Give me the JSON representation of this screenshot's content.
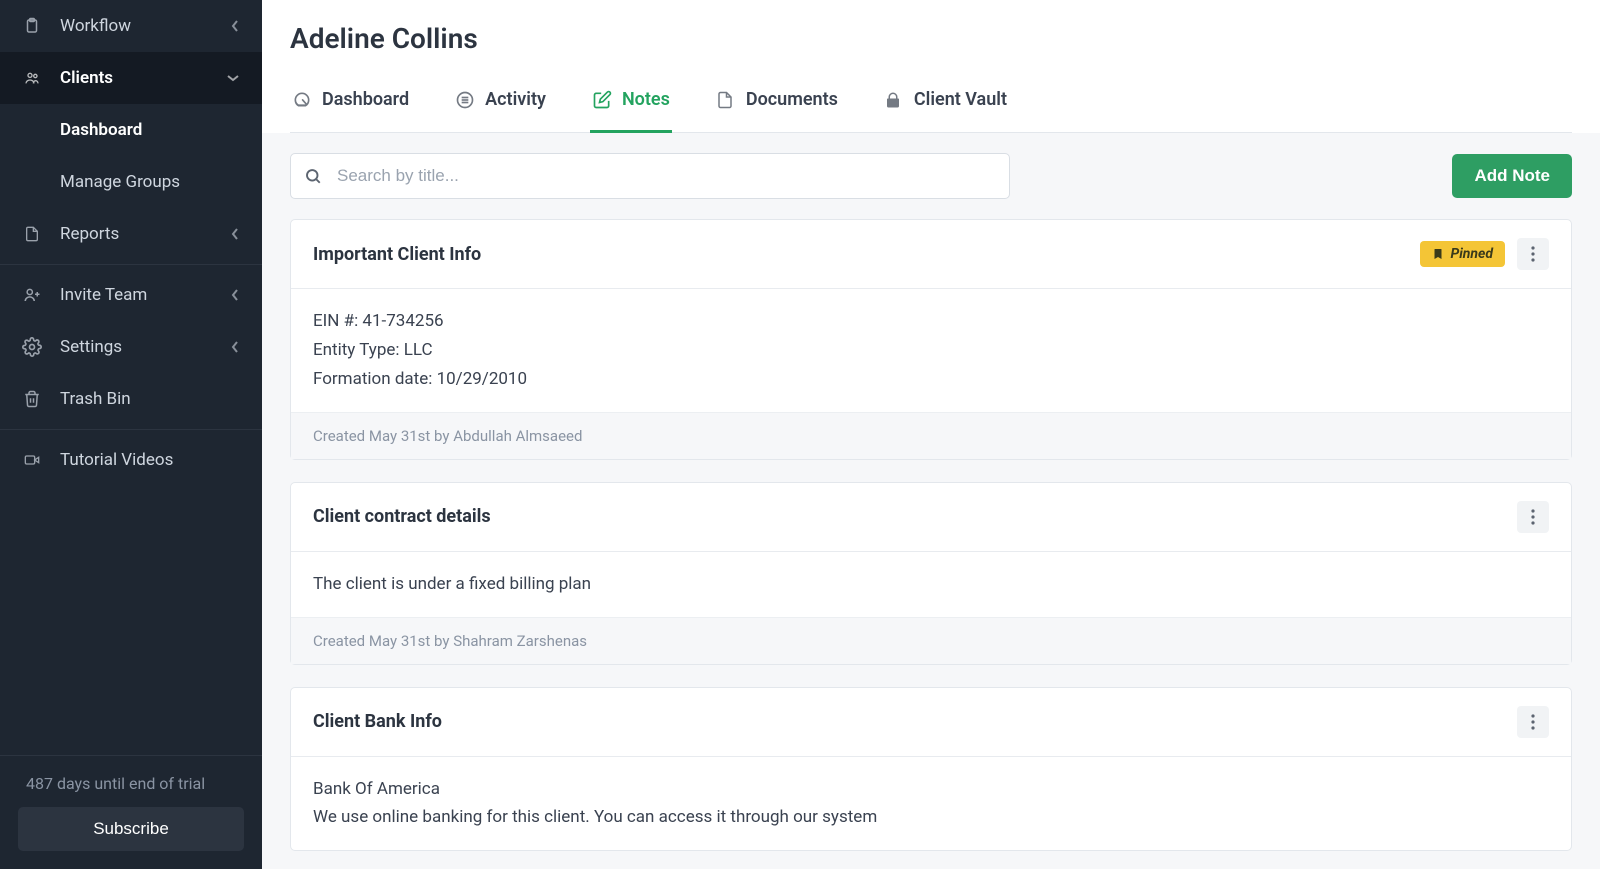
{
  "sidebar": {
    "items": [
      {
        "key": "workflow",
        "label": "Workflow",
        "icon": "clipboard-icon",
        "chevron": "left"
      },
      {
        "key": "clients",
        "label": "Clients",
        "icon": "people-icon",
        "chevron": "down",
        "expanded": true,
        "children": [
          {
            "key": "dashboard",
            "label": "Dashboard",
            "active": true
          },
          {
            "key": "manage-groups",
            "label": "Manage Groups"
          }
        ]
      },
      {
        "key": "reports",
        "label": "Reports",
        "icon": "file-icon",
        "chevron": "left"
      }
    ],
    "admin": [
      {
        "key": "invite-team",
        "label": "Invite Team",
        "icon": "user-plus-icon",
        "chevron": "left"
      },
      {
        "key": "settings",
        "label": "Settings",
        "icon": "gear-icon",
        "chevron": "left"
      },
      {
        "key": "trash-bin",
        "label": "Trash Bin",
        "icon": "trash-icon"
      }
    ],
    "footer": [
      {
        "key": "tutorial-videos",
        "label": "Tutorial Videos",
        "icon": "video-icon"
      }
    ],
    "trial": "487 days until end of trial",
    "subscribe": "Subscribe"
  },
  "header": {
    "title": "Adeline Collins",
    "tabs": [
      {
        "key": "dashboard",
        "label": "Dashboard",
        "icon": "dashboard-icon"
      },
      {
        "key": "activity",
        "label": "Activity",
        "icon": "list-icon"
      },
      {
        "key": "notes",
        "label": "Notes",
        "icon": "note-edit-icon",
        "active": true
      },
      {
        "key": "documents",
        "label": "Documents",
        "icon": "file-icon"
      },
      {
        "key": "client-vault",
        "label": "Client Vault",
        "icon": "lock-icon"
      }
    ]
  },
  "toolbar": {
    "search_placeholder": "Search by title...",
    "add_button": "Add Note"
  },
  "pinned_label": "Pinned",
  "notes": [
    {
      "title": "Important Client Info",
      "pinned": true,
      "body": "EIN #: 41-734256\nEntity Type: LLC\nFormation date: 10/29/2010",
      "meta": "Created May 31st by Abdullah Almsaeed",
      "show_footer": true
    },
    {
      "title": "Client contract details",
      "pinned": false,
      "body": "The client is under a fixed billing plan",
      "meta": "Created May 31st by Shahram Zarshenas",
      "show_footer": true
    },
    {
      "title": "Client Bank Info",
      "pinned": false,
      "body": "Bank Of America\nWe use online banking for this client. You can access it through our system",
      "meta": "",
      "show_footer": false
    }
  ]
}
